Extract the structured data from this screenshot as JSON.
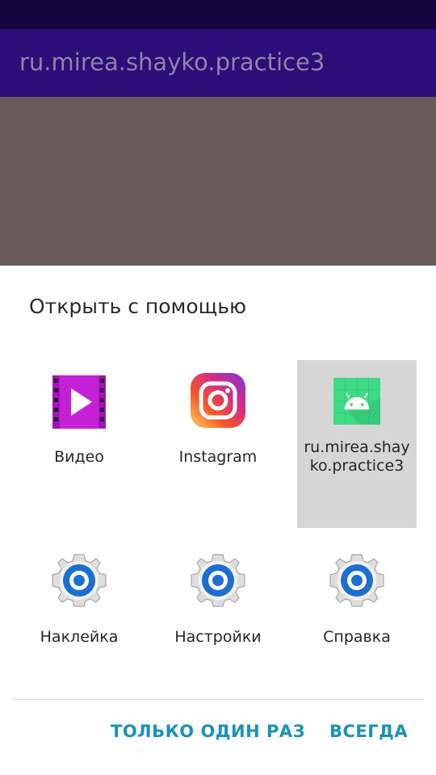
{
  "app_bar": {
    "title": "ru.mirea.shayko.practice3"
  },
  "chooser": {
    "title": "Открыть с помощью",
    "apps": [
      {
        "label": "Видео",
        "icon": "video-player-icon"
      },
      {
        "label": "Instagram",
        "icon": "instagram-icon"
      },
      {
        "label": "ru.mirea.shayko.practice3",
        "icon": "android-icon",
        "selected": true
      },
      {
        "label": "Наклейка",
        "icon": "gear-icon"
      },
      {
        "label": "Настройки",
        "icon": "gear-icon"
      },
      {
        "label": "Справка",
        "icon": "gear-icon"
      }
    ],
    "just_once_label": "ТОЛЬКО ОДИН РАЗ",
    "always_label": "ВСЕГДА"
  },
  "colors": {
    "status_bar": "#14063f",
    "app_bar": "#2b0e78",
    "dim_overlay": "#665a5a",
    "accent": "#1a93b3",
    "selected_tile": "#d6d6d6"
  }
}
